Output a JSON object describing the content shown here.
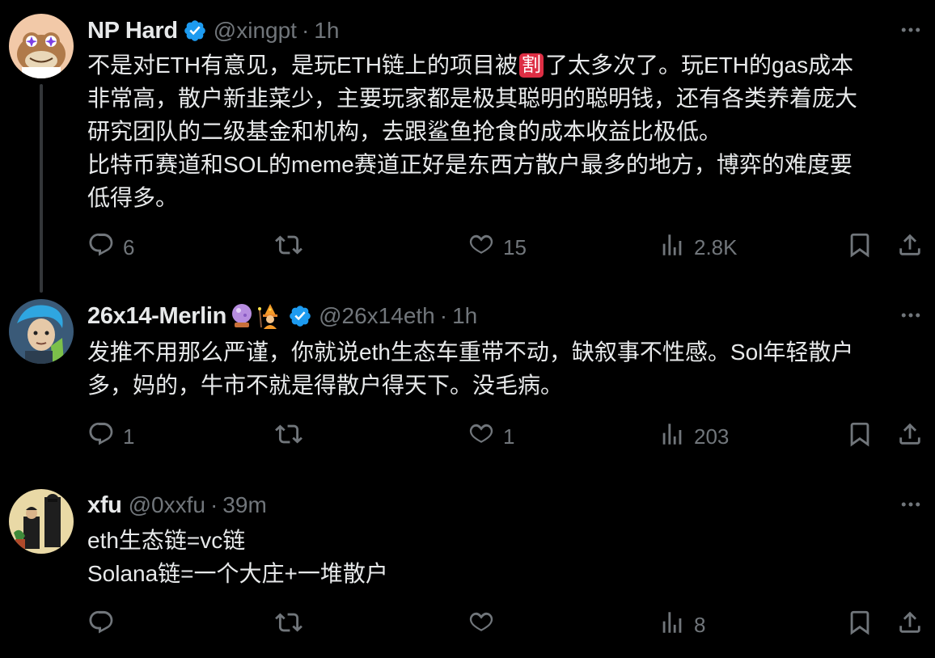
{
  "tweets": [
    {
      "name": "NP Hard",
      "handle": "@xingpt",
      "dot": "·",
      "time": "1h",
      "verified": true,
      "text_before_emoji": "不是对ETH有意见，是玩ETH链上的项目被",
      "cut_emoji": "割",
      "text_after_emoji": "了太多次了。玩ETH的gas成本",
      "lines": [
        "非常高，散户新韭菜少，主要玩家都是极其聪明的聪明钱，还有各类养着庞大",
        "研究团队的二级基金和机构，去跟鲨鱼抢食的成本收益比极低。",
        "比特币赛道和SOL的meme赛道正好是东西方散户最多的地方，博弈的难度要",
        "低得多。"
      ],
      "replies": "6",
      "reposts": "",
      "likes": "15",
      "views": "2.8K"
    },
    {
      "name": "26x14-Merlin",
      "handle": "@26x14eth",
      "dot": "·",
      "time": "1h",
      "verified": true,
      "emojis": [
        "crystal-ball",
        "mage"
      ],
      "lines": [
        "发推不用那么严谨，你就说eth生态车重带不动，缺叙事不性感。Sol年轻散户",
        "多，妈的，牛市不就是得散户得天下。没毛病。"
      ],
      "replies": "1",
      "reposts": "",
      "likes": "1",
      "views": "203"
    },
    {
      "name": "xfu",
      "handle": "@0xxfu",
      "dot": "·",
      "time": "39m",
      "verified": false,
      "lines": [
        "eth生态链=vc链",
        "Solana链=一个大庄+一堆散户"
      ],
      "replies": "",
      "reposts": "",
      "likes": "",
      "views": "8"
    }
  ],
  "colors": {
    "background": "#000000",
    "text": "#e7e9ea",
    "muted": "#71767b",
    "verified": "#1d9bf0",
    "thread_line": "#333639"
  }
}
